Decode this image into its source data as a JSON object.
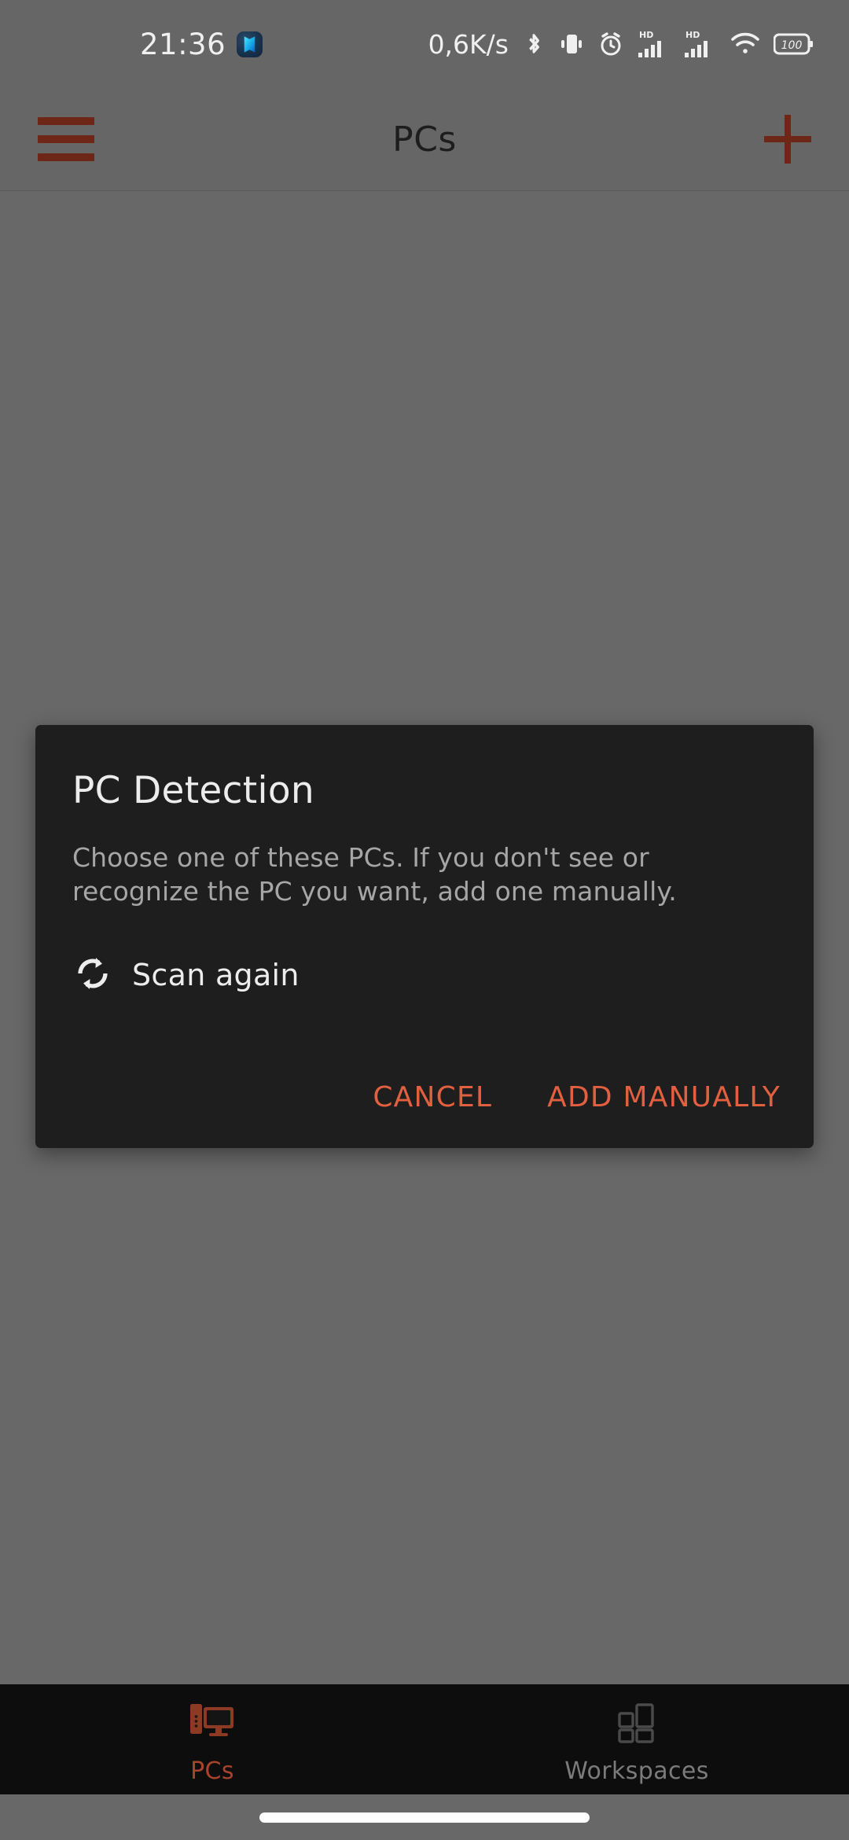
{
  "status_bar": {
    "time": "21:36",
    "app_icon": "blue-app-notification-icon",
    "network_speed": "0,6K/s",
    "icons": [
      "bluetooth-icon",
      "vibrate-icon",
      "alarm-clock-icon",
      "hd-signal-bars-icon-sim1",
      "hd-signal-bars-icon-sim2",
      "wifi-icon",
      "battery-icon"
    ],
    "battery_level": "100"
  },
  "toolbar": {
    "menu_icon": "hamburger-menu-icon",
    "title": "PCs",
    "add_icon": "plus-icon",
    "accent_color": "#6e2617"
  },
  "dialog": {
    "title": "PC Detection",
    "body": "Choose one of these PCs. If you don't see or recognize the PC you want, add one manually.",
    "scan_icon": "refresh-sync-icon",
    "scan_label": "Scan again",
    "cancel_label": "CANCEL",
    "add_manually_label": "ADD MANUALLY",
    "action_color": "#e2603f",
    "background_color": "#1e1e1e"
  },
  "bottom_nav": {
    "items": [
      {
        "label": "PCs",
        "icon": "desktop-computer-icon",
        "active": true
      },
      {
        "label": "Workspaces",
        "icon": "grid-panels-icon",
        "active": false
      }
    ],
    "active_color": "#a8432c",
    "inactive_color": "#7b7b7b"
  },
  "gesture_bar": {
    "indicator": "home-indicator"
  }
}
